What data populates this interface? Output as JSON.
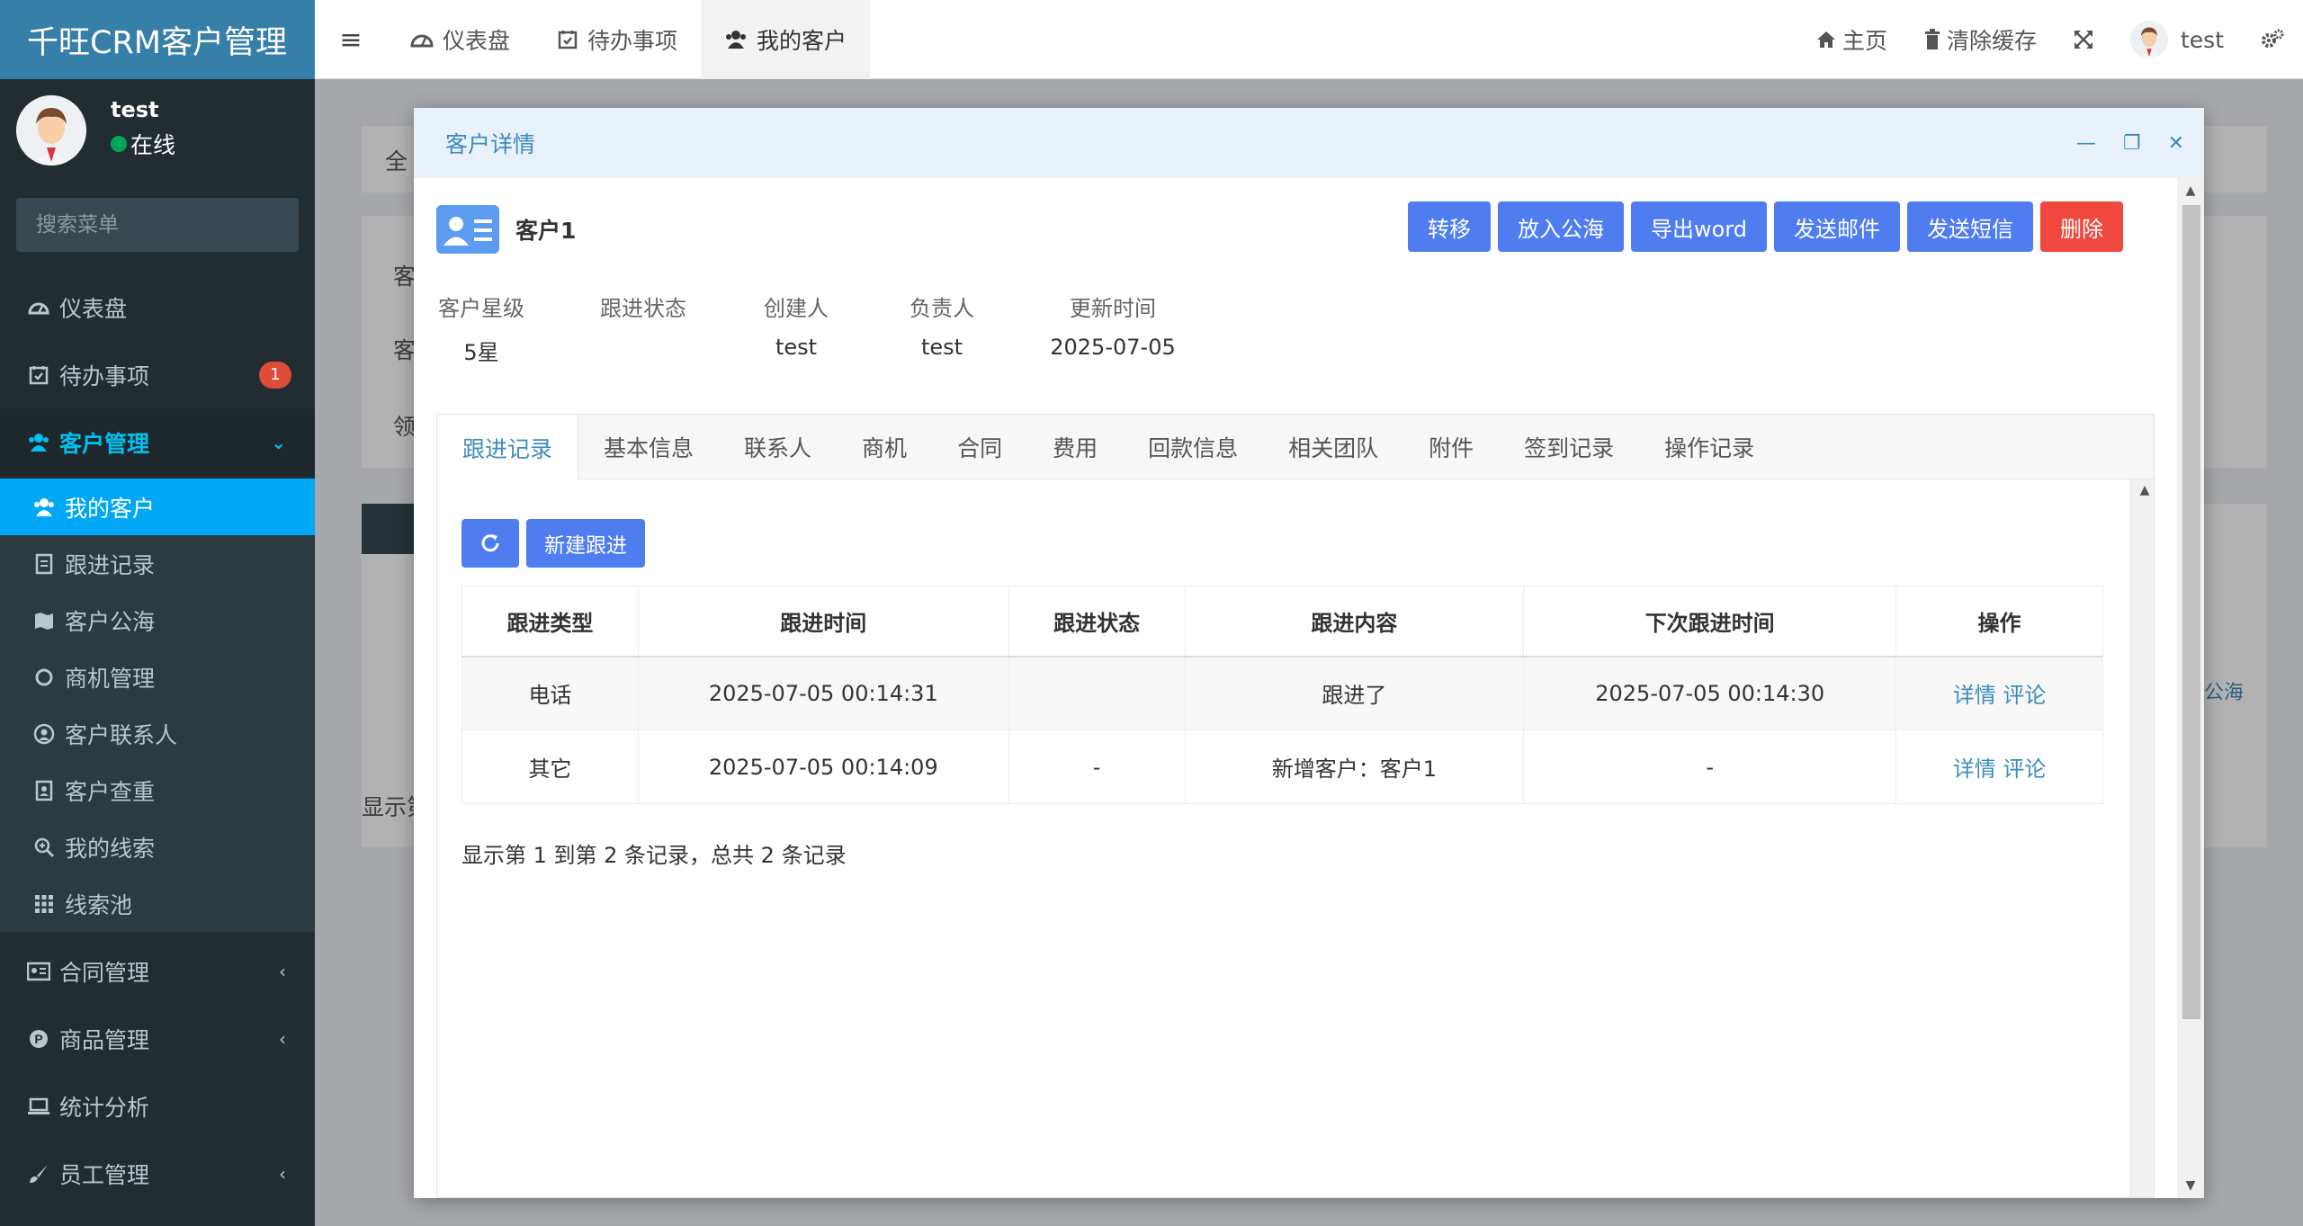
{
  "app": {
    "title": "千旺CRM客户管理",
    "user_name": "test",
    "user_status": "在线",
    "search_placeholder": "搜索菜单"
  },
  "sidebar": {
    "menu": [
      {
        "label": "仪表盘",
        "icon": "dashboard-icon"
      },
      {
        "label": "待办事项",
        "icon": "calendar-check-icon",
        "badge": "1"
      },
      {
        "label": "客户管理",
        "icon": "users-icon",
        "expanded": true
      }
    ],
    "submenu": [
      {
        "label": "我的客户",
        "icon": "users-icon",
        "active": true
      },
      {
        "label": "跟进记录",
        "icon": "file-text-icon"
      },
      {
        "label": "客户公海",
        "icon": "map-icon"
      },
      {
        "label": "商机管理",
        "icon": "circle-icon"
      },
      {
        "label": "客户联系人",
        "icon": "user-circle-icon"
      },
      {
        "label": "客户查重",
        "icon": "contact-card-icon"
      },
      {
        "label": "我的线索",
        "icon": "search-plus-icon"
      },
      {
        "label": "线索池",
        "icon": "grid-icon"
      }
    ],
    "menu_after": [
      {
        "label": "合同管理",
        "icon": "id-card-icon"
      },
      {
        "label": "商品管理",
        "icon": "product-icon"
      },
      {
        "label": "统计分析",
        "icon": "laptop-icon"
      },
      {
        "label": "员工管理",
        "icon": "brush-icon"
      }
    ]
  },
  "topbar": {
    "tabs": [
      {
        "label": "仪表盘"
      },
      {
        "label": "待办事项"
      },
      {
        "label": "我的客户"
      }
    ],
    "right": {
      "home": "主页",
      "clear_cache": "清除缓存",
      "user": "test"
    }
  },
  "background": {
    "tab_fragment": "全",
    "label1": "客",
    "label2": "客",
    "label3": "领",
    "footer_fragment": "显示第",
    "link_fragment": "公海"
  },
  "modal": {
    "title": "客户详情",
    "customer_name": "客户1",
    "actions": {
      "transfer": "转移",
      "to_pool": "放入公海",
      "export_word": "导出word",
      "send_email": "发送邮件",
      "send_sms": "发送短信",
      "delete": "删除"
    },
    "info": [
      {
        "label": "客户星级",
        "value": "5星"
      },
      {
        "label": "跟进状态",
        "value": ""
      },
      {
        "label": "创建人",
        "value": "test"
      },
      {
        "label": "负责人",
        "value": "test"
      },
      {
        "label": "更新时间",
        "value": "2025-07-05"
      }
    ],
    "tabs": [
      "跟进记录",
      "基本信息",
      "联系人",
      "商机",
      "合同",
      "费用",
      "回款信息",
      "相关团队",
      "附件",
      "签到记录",
      "操作记录"
    ],
    "new_followup": "新建跟进",
    "table": {
      "headers": [
        "跟进类型",
        "跟进时间",
        "跟进状态",
        "跟进内容",
        "下次跟进时间",
        "操作"
      ],
      "rows": [
        {
          "type": "电话",
          "time": "2025-07-05 00:14:31",
          "status": "",
          "content": "跟进了",
          "next": "2025-07-05 00:14:30",
          "detail": "详情",
          "comment": "评论"
        },
        {
          "type": "其它",
          "time": "2025-07-05 00:14:09",
          "status": "-",
          "content": "新增客户：客户1",
          "next": "-",
          "detail": "详情",
          "comment": "评论"
        }
      ]
    },
    "pager": "显示第 1 到第 2 条记录，总共 2 条记录"
  },
  "colors": {
    "sidebar_bg": "#222d32",
    "logo_bg": "#367fa9",
    "active_menu": "#00a7f5",
    "primary_btn": "#4f7df0",
    "danger_btn": "#f0483e",
    "badge": "#dd4b39",
    "link": "#3c8dbc"
  }
}
